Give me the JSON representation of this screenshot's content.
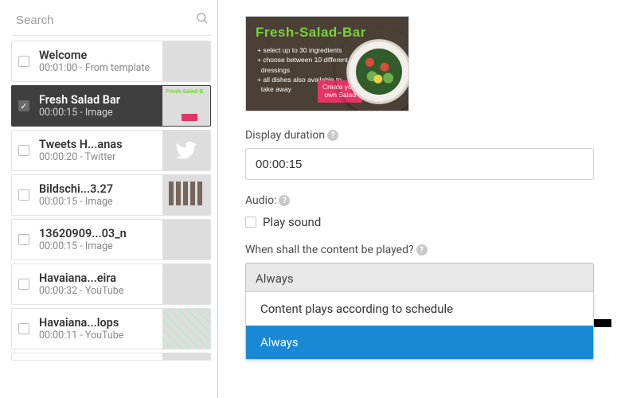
{
  "sidebar": {
    "search_placeholder": "Search",
    "items": [
      {
        "title": "Welcome",
        "sub": "00:01:00 - From template",
        "thumb": "th-collage",
        "selected": false
      },
      {
        "title": "Fresh Salad Bar",
        "sub": "00:00:15 - Image",
        "thumb": "th-salad",
        "selected": true
      },
      {
        "title": "Tweets H...anas",
        "sub": "00:00:20 - Twitter",
        "thumb": "th-twitter",
        "selected": false
      },
      {
        "title": "Bildschi...3.27",
        "sub": "00:00:15 - Image",
        "thumb": "th-shop",
        "selected": false
      },
      {
        "title": "13620909...03_n",
        "sub": "00:00:15 - Image",
        "thumb": "th-drinks",
        "selected": false
      },
      {
        "title": "Havaiana...eira",
        "sub": "00:00:32 - YouTube",
        "thumb": "th-woman",
        "selected": false
      },
      {
        "title": "Havaiana...lops",
        "sub": "00:00:11 - YouTube",
        "thumb": "th-green",
        "selected": false
      }
    ]
  },
  "preview": {
    "title": "Fresh-Salad-Bar",
    "bullets": "+ select up to 30 ingredients\n+ choose between 10 different\n  dressings\n+ all dishes also available to\n  take away",
    "badge": "Create your\nown Salad"
  },
  "detail": {
    "duration_label": "Display duration",
    "duration_value": "00:00:15",
    "audio_label": "Audio:",
    "play_sound_label": "Play sound",
    "play_sound_checked": false,
    "when_label": "When shall the content be played?",
    "when_selected": "Always",
    "when_options": [
      {
        "label": "Content plays according to schedule",
        "highlight": false
      },
      {
        "label": "Always",
        "highlight": true
      }
    ]
  }
}
